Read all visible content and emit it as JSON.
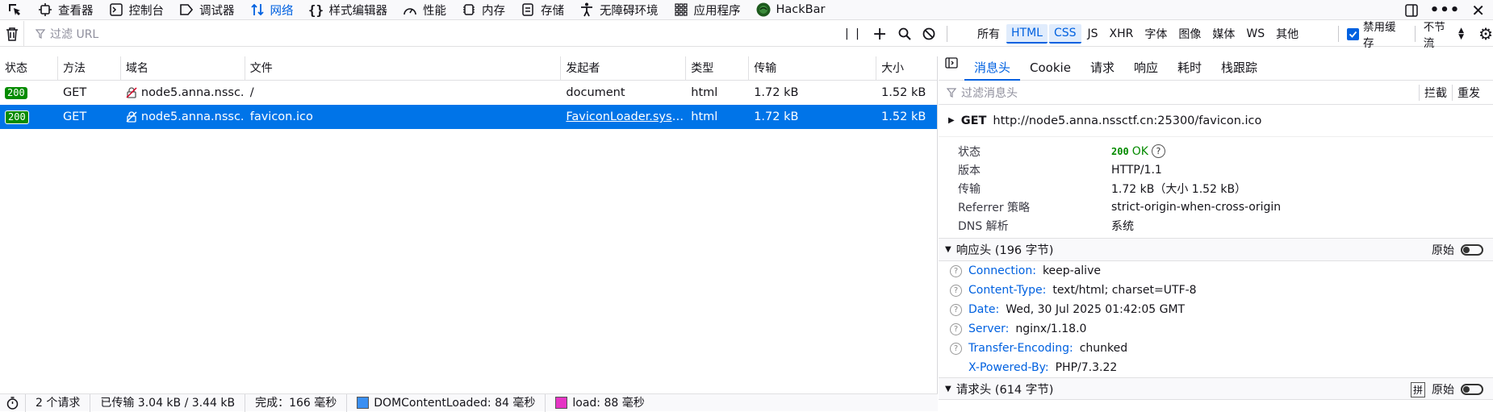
{
  "toolbar": {
    "tools": [
      {
        "label": "查看器",
        "icon": "inspector-icon"
      },
      {
        "label": "控制台",
        "icon": "console-icon"
      },
      {
        "label": "调试器",
        "icon": "debugger-icon"
      },
      {
        "label": "网络",
        "icon": "network-icon",
        "active": true
      },
      {
        "label": "样式编辑器",
        "icon": "style-editor-icon"
      },
      {
        "label": "性能",
        "icon": "performance-icon"
      },
      {
        "label": "内存",
        "icon": "memory-icon"
      },
      {
        "label": "存储",
        "icon": "storage-icon"
      },
      {
        "label": "无障碍环境",
        "icon": "accessibility-icon"
      },
      {
        "label": "应用程序",
        "icon": "application-icon"
      },
      {
        "label": "HackBar",
        "icon": "hackbar-icon"
      }
    ]
  },
  "filter": {
    "placeholder": "过滤 URL",
    "types": [
      "所有",
      "HTML",
      "CSS",
      "JS",
      "XHR",
      "字体",
      "图像",
      "媒体",
      "WS",
      "其他"
    ],
    "active_types": [
      "HTML",
      "CSS"
    ],
    "disable_cache_label": "禁用缓存",
    "throttle_label": "不节流"
  },
  "table": {
    "headers": [
      "状态",
      "方法",
      "域名",
      "文件",
      "发起者",
      "类型",
      "传输",
      "大小"
    ],
    "rows": [
      {
        "status": "200",
        "method": "GET",
        "domain": "node5.anna.nssc...",
        "file": "/",
        "initiator": "document",
        "type": "html",
        "transferred": "1.72 kB",
        "size": "1.52 kB",
        "selected": false
      },
      {
        "status": "200",
        "method": "GET",
        "domain": "node5.anna.nssc...",
        "file": "favicon.ico",
        "initiator": "FaviconLoader.sys....",
        "type": "html",
        "transferred": "1.72 kB",
        "size": "1.52 kB",
        "selected": true
      }
    ]
  },
  "statusbar": {
    "requests": "2 个请求",
    "transferred": "已传输 3.04 kB / 3.44 kB",
    "finish": "完成：166 毫秒",
    "domcontentloaded": "DOMContentLoaded: 84 毫秒",
    "load": "load: 88 毫秒",
    "dcl_color": "#3a8ff2",
    "load_color": "#e535c4"
  },
  "panel": {
    "tabs": [
      "消息头",
      "Cookie",
      "请求",
      "响应",
      "耗时",
      "栈跟踪"
    ],
    "filter_placeholder": "过滤消息头",
    "block_label": "拦截",
    "resend_label": "重发",
    "request_method": "GET",
    "request_url": "http://node5.anna.nssctf.cn:25300/favicon.ico",
    "summary": {
      "status_label": "状态",
      "status_code": "200",
      "status_text": "OK",
      "version_label": "版本",
      "version": "HTTP/1.1",
      "transfer_label": "传输",
      "transfer": "1.72 kB（大小 1.52 kB）",
      "referrer_label": "Referrer 策略",
      "referrer": "strict-origin-when-cross-origin",
      "dns_label": "DNS 解析",
      "dns": "系统"
    },
    "response_headers_title": "响应头 (196 字节)",
    "raw_label": "原始",
    "response_headers": [
      {
        "name": "Connection:",
        "value": "keep-alive",
        "help": true
      },
      {
        "name": "Content-Type:",
        "value": "text/html; charset=UTF-8",
        "help": true
      },
      {
        "name": "Date:",
        "value": "Wed, 30 Jul 2025 01:42:05 GMT",
        "help": true
      },
      {
        "name": "Server:",
        "value": "nginx/1.18.0",
        "help": true
      },
      {
        "name": "Transfer-Encoding:",
        "value": "chunked",
        "help": true
      },
      {
        "name": "X-Powered-By:",
        "value": "PHP/7.3.22",
        "help": false
      }
    ],
    "request_headers_title": "请求头 (614 字节)"
  }
}
